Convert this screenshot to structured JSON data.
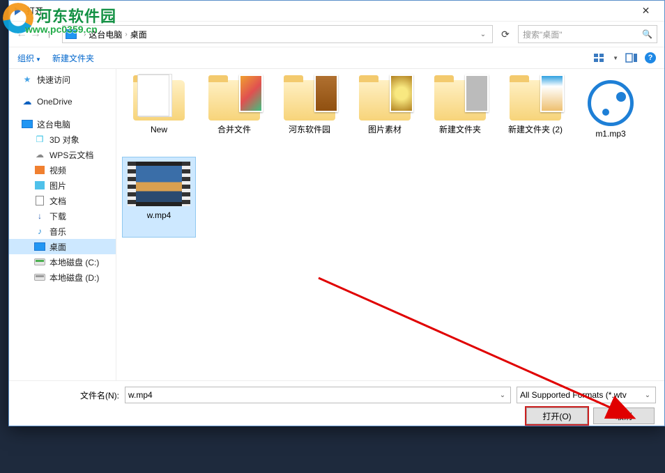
{
  "watermark": {
    "title": "河东软件园",
    "url": "www.pc0359.cn"
  },
  "title": "打开",
  "breadcrumb": {
    "root_icon": "monitor",
    "parts": [
      "这台电脑",
      "桌面"
    ]
  },
  "search": {
    "placeholder": "搜索\"桌面\""
  },
  "toolbar": {
    "organize": "组织",
    "newfolder": "新建文件夹"
  },
  "sidebar": [
    {
      "id": "quick",
      "label": "快速访问",
      "icon": "star",
      "level": 1
    },
    {
      "id": "onedrive",
      "label": "OneDrive",
      "icon": "onedrive",
      "level": 1
    },
    {
      "id": "thispc",
      "label": "这台电脑",
      "icon": "monitor",
      "level": 1
    },
    {
      "id": "3dobj",
      "label": "3D 对象",
      "icon": "cube",
      "level": 2
    },
    {
      "id": "wpscloud",
      "label": "WPS云文档",
      "icon": "cloud",
      "level": 2
    },
    {
      "id": "videos",
      "label": "视频",
      "icon": "video",
      "level": 2
    },
    {
      "id": "pics",
      "label": "图片",
      "icon": "picture",
      "level": 2
    },
    {
      "id": "docs",
      "label": "文档",
      "icon": "doc",
      "level": 2
    },
    {
      "id": "dl",
      "label": "下载",
      "icon": "download",
      "level": 2
    },
    {
      "id": "music",
      "label": "音乐",
      "icon": "music",
      "level": 2
    },
    {
      "id": "desktop",
      "label": "桌面",
      "icon": "monitor",
      "level": 2,
      "selected": true
    },
    {
      "id": "cdrive",
      "label": "本地磁盘 (C:)",
      "icon": "drive",
      "level": 2
    },
    {
      "id": "ddrive",
      "label": "本地磁盘 (D:)",
      "icon": "drive2",
      "level": 2
    }
  ],
  "files": [
    {
      "name": "New",
      "type": "folder",
      "thumb": "pages"
    },
    {
      "name": "合并文件",
      "type": "folder",
      "thumb": "a"
    },
    {
      "name": "河东软件园",
      "type": "folder",
      "thumb": "b"
    },
    {
      "name": "图片素材",
      "type": "folder",
      "thumb": "c"
    },
    {
      "name": "新建文件夹",
      "type": "folder",
      "thumb": "d"
    },
    {
      "name": "新建文件夹 (2)",
      "type": "folder",
      "thumb": "e"
    },
    {
      "name": "m1.mp3",
      "type": "audio"
    },
    {
      "name": "w.mp4",
      "type": "video",
      "selected": true
    }
  ],
  "footer": {
    "filename_label": "文件名(N):",
    "filename_value": "w.mp4",
    "filter_label": "All Supported Formats (*.wtv",
    "open": "打开(O)",
    "cancel": "取消"
  }
}
